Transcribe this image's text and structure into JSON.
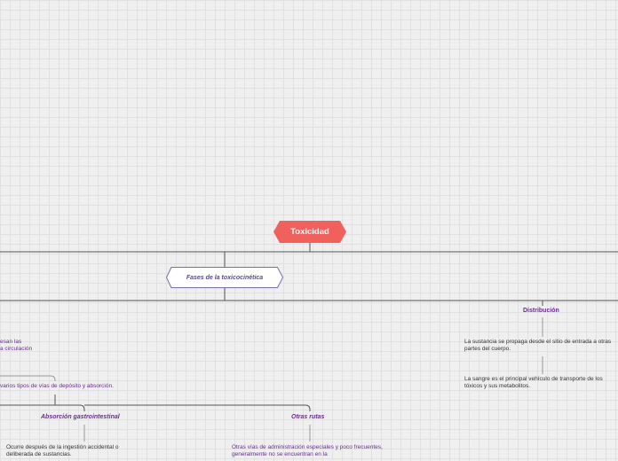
{
  "root": {
    "label": "Toxicidad"
  },
  "phases": {
    "label": "Fases de la toxicocinética"
  },
  "distribution": {
    "title": "Distribución",
    "text1": "La sustancia se propaga desde el sitio de entrada a otras partes del cuerpo.",
    "text2": "La sangre es el principal vehículo de transporte de los tóxicos y sus metabolitos."
  },
  "absorption": {
    "fragment1_line1": "esan las",
    "fragment1_line2": "a circulación",
    "fragment2": "varios tipos de vías de depósito y absorción."
  },
  "gastro": {
    "title": "Absorción gastrointestinal",
    "text": "Ocurre después de la ingestión accidental o deliberada de sustancias."
  },
  "other_routes": {
    "title": "Otras rutas",
    "text": "Otras vías de administración especiales y  poco frecuentes, generalmente no se encuentran en la"
  },
  "colors": {
    "root_fill": "#f0605d",
    "phase_border": "#7b6bb0",
    "label_purple": "#6b2d8f",
    "connector": "#555555"
  }
}
